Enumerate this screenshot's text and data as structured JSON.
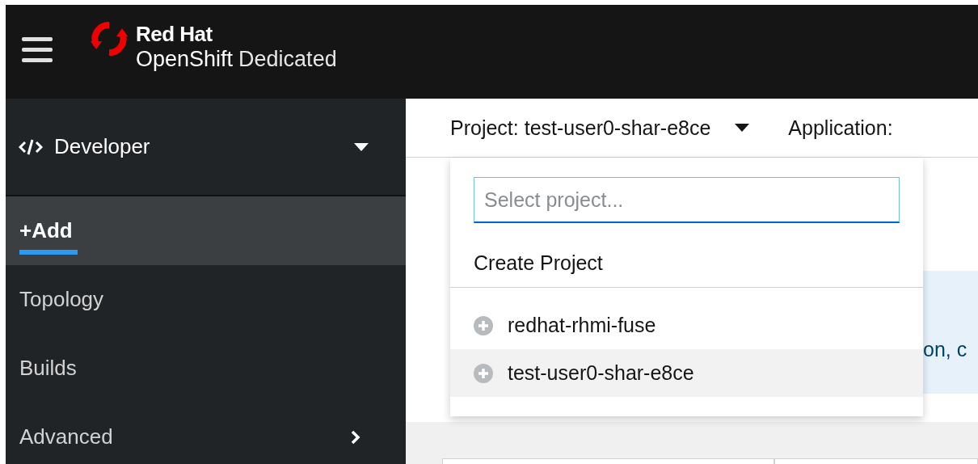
{
  "masthead": {
    "brand_top": "Red Hat",
    "product": "OpenShift",
    "edition": "Dedicated"
  },
  "perspective": {
    "label": "Developer"
  },
  "nav": [
    {
      "label": "+Add",
      "selected": true,
      "kind": "link"
    },
    {
      "label": "Topology",
      "selected": false,
      "kind": "link"
    },
    {
      "label": "Builds",
      "selected": false,
      "kind": "link"
    },
    {
      "label": "Advanced",
      "selected": false,
      "kind": "group"
    }
  ],
  "context_bar": {
    "project": "Project: test-user0-shar-e8ce",
    "application": "Application:"
  },
  "project_menu": {
    "search": {
      "placeholder": "Select project..."
    },
    "create": "Create Project",
    "projects": [
      {
        "name": "redhat-rhmi-fuse",
        "selected": false
      },
      {
        "name": "test-user0-shar-e8ce",
        "selected": true
      }
    ]
  },
  "alert": {
    "text": "on, c"
  }
}
